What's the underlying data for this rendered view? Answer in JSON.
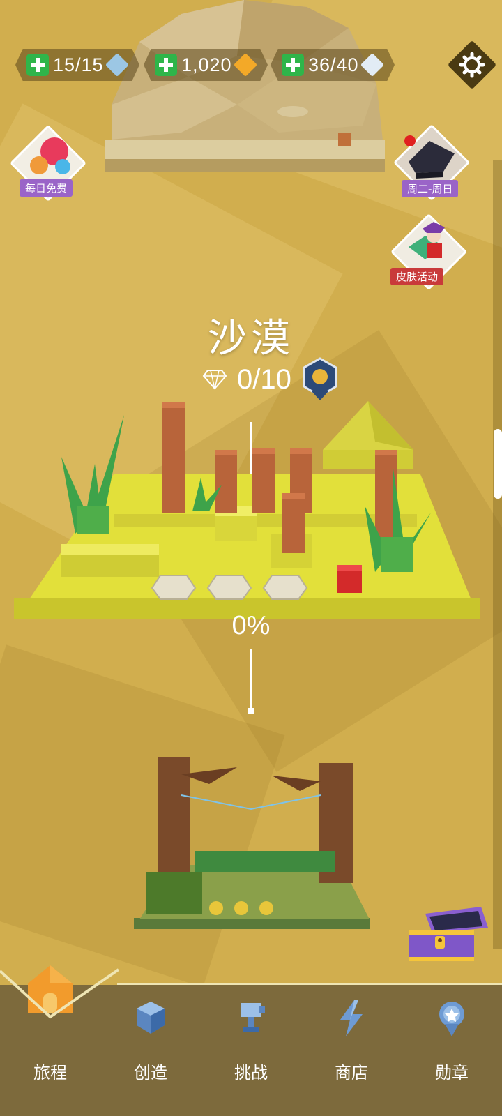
{
  "resources": [
    {
      "value": "15/15",
      "gem_color": "#9cc7e4",
      "gem_name": "blue-cube-icon"
    },
    {
      "value": "1,020",
      "gem_color": "#f3a928",
      "gem_name": "gold-cube-icon"
    },
    {
      "value": "36/40",
      "gem_color": "#e2ecf5",
      "gem_name": "fragment-icon"
    }
  ],
  "side": {
    "daily_label": "每日免费",
    "weekend_label": "周二-周日",
    "skin_label": "皮肤活动"
  },
  "level": {
    "title": "沙漠",
    "gems": "0/10",
    "progress": "0%"
  },
  "nav": {
    "items": [
      {
        "label": "旅程",
        "icon": "house-icon",
        "active": true
      },
      {
        "label": "创造",
        "icon": "cube-icon"
      },
      {
        "label": "挑战",
        "icon": "trophy-icon"
      },
      {
        "label": "商店",
        "icon": "lightning-icon"
      },
      {
        "label": "勋章",
        "icon": "medal-icon"
      }
    ]
  },
  "colors": {
    "background": "#d1ae4e",
    "platform": "#e2e03a",
    "pillar": "#b8643a",
    "player": "#d32a2a",
    "plus": "#2fb54a",
    "nav": "#7d6a3c"
  }
}
